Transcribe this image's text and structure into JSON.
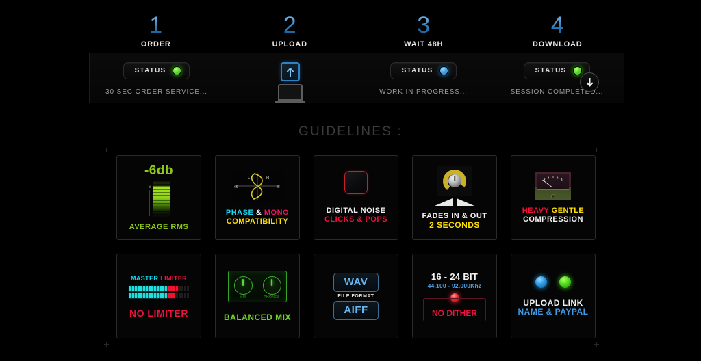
{
  "steps": [
    {
      "num": "1",
      "label": "ORDER"
    },
    {
      "num": "2",
      "label": "UPLOAD"
    },
    {
      "num": "3",
      "label": "WAIT 48H"
    },
    {
      "num": "4",
      "label": "DOWNLOAD"
    }
  ],
  "status_bar": {
    "status_label": "STATUS",
    "col1": {
      "caption": "30 SEC ORDER SERVICE...",
      "led": "green"
    },
    "col2": {
      "icon": "upload-arrow-icon",
      "device": "laptop-icon"
    },
    "col3": {
      "caption": "WORK IN PROGRESS...",
      "led": "blue"
    },
    "col4": {
      "caption": "SESSION COMPLETED...",
      "led": "green",
      "download_icon": "download-arrow-icon"
    }
  },
  "guidelines_heading": "GUIDELINES :",
  "cards": [
    {
      "id": "average-rms",
      "value": "-6db",
      "scale_tick": "-6",
      "line1": "AVERAGE RMS",
      "line1_color": "#8cc71a"
    },
    {
      "id": "phase-mono",
      "scope_labels": {
        "left": "L",
        "right": "R",
        "plus": "+S",
        "minus": "-S"
      },
      "line1_a": "PHASE ",
      "line1_b": "& ",
      "line1_c": "MONO",
      "line2": "COMPATIBILITY",
      "colors": {
        "phase": "#16d8f0",
        "amp": "#f2f2f2",
        "mono": "#f2105e",
        "compat": "#ffe000"
      }
    },
    {
      "id": "digital-noise",
      "line1": "DIGITAL NOISE",
      "line2": "CLICKS & POPS",
      "line1_color": "#f2f2f2",
      "line2_color": "#f2103c"
    },
    {
      "id": "fades",
      "line1": "FADES IN & OUT",
      "line2": "2 SECONDS",
      "line1_color": "#f2f2f2",
      "line2_color": "#ffe000"
    },
    {
      "id": "compression",
      "line1_a": "HEAVY ",
      "line1_b": "GENTLE",
      "line2": "COMPRESSION",
      "colors": {
        "heavy": "#f2103c",
        "gentle": "#ffe000",
        "compression": "#f2f2f2"
      }
    },
    {
      "id": "no-limiter",
      "top_a": "MASTER ",
      "top_b": "LIMITER",
      "line1": "NO LIMITER",
      "colors": {
        "master": "#16d8f0",
        "limiter": "#f2103c",
        "nolimiter": "#f2103c"
      }
    },
    {
      "id": "balanced-mix",
      "knob1": "MIX",
      "knob2": "PHONES",
      "line1": "BALANCED MIX",
      "line1_color": "#6fd22a"
    },
    {
      "id": "file-format",
      "fmt1": "WAV",
      "mid": "FILE FORMAT",
      "fmt2": "AIFF",
      "fmt_color": "#68b6ef"
    },
    {
      "id": "bit-depth",
      "top": "16 - 24 BIT",
      "sub": "44.100 - 92.000Khz",
      "line1": "NO DITHER",
      "line1_color": "#f2103c"
    },
    {
      "id": "upload-link",
      "line1": "UPLOAD LINK",
      "line2": "NAME & PAYPAL",
      "line1_color": "#f2f2f2",
      "line2_color": "#3f9ae8"
    }
  ]
}
